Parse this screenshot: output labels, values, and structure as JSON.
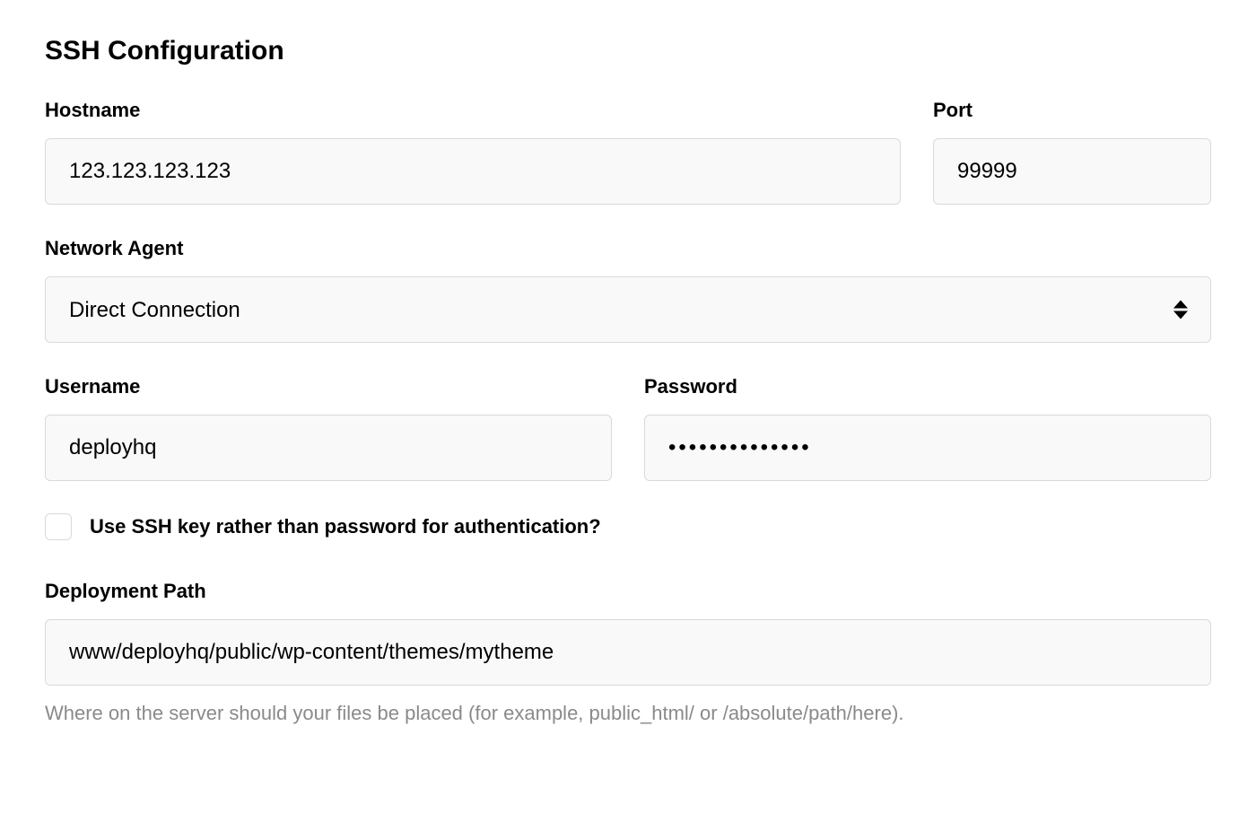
{
  "section": {
    "title": "SSH Configuration"
  },
  "fields": {
    "hostname": {
      "label": "Hostname",
      "value": "123.123.123.123"
    },
    "port": {
      "label": "Port",
      "value": "99999"
    },
    "network_agent": {
      "label": "Network Agent",
      "selected": "Direct Connection"
    },
    "username": {
      "label": "Username",
      "value": "deployhq"
    },
    "password": {
      "label": "Password",
      "value": "••••••••••••••"
    },
    "ssh_key_checkbox": {
      "label": "Use SSH key rather than password for authentication?",
      "checked": false
    },
    "deployment_path": {
      "label": "Deployment Path",
      "value": "www/deployhq/public/wp-content/themes/mytheme",
      "help": "Where on the server should your files be placed (for example, public_html/ or /absolute/path/here)."
    }
  }
}
